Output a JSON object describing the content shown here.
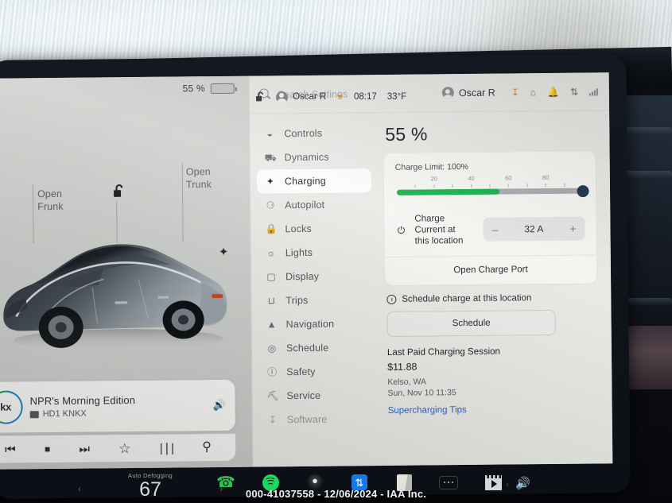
{
  "photo": {
    "watermark": "000-41037558 - 12/06/2024 - IAA Inc."
  },
  "vehicle_panel": {
    "battery_percent": "55 %",
    "controls": [
      {
        "label": "Open\nFrunk",
        "name": "open-frunk"
      },
      {
        "label": "Open\nTrunk",
        "name": "open-trunk"
      }
    ],
    "frunk_label_line1": "Open",
    "frunk_label_line2": "Frunk",
    "trunk_label_line1": "Open",
    "trunk_label_line2": "Trunk",
    "lock_icon": "unlocked-padlock-icon",
    "charge_bolt_icon": "lightning-bolt-icon"
  },
  "media": {
    "station_logo": "knkx",
    "title": "NPR's Morning Edition",
    "subtitle": "HD1 KNKX",
    "volume_icon": "volume-icon",
    "controls": [
      {
        "name": "previous-track-button",
        "glyph": "⏮"
      },
      {
        "name": "stop-button",
        "glyph": "■"
      },
      {
        "name": "next-track-button",
        "glyph": "⏭"
      },
      {
        "name": "favorite-button",
        "glyph": "☆"
      },
      {
        "name": "equalizer-button",
        "glyph": "⦀"
      },
      {
        "name": "search-media-button",
        "glyph": "⌕"
      }
    ]
  },
  "status_bar": {
    "lock_icon": "unlocked-padlock-icon",
    "driver_profile": "Oscar R",
    "charge_icon": "charge-icon",
    "time": "08:17",
    "temperature": "33°F"
  },
  "settings": {
    "search": {
      "placeholder": "Search Settings",
      "icon": "search-icon"
    },
    "header_user": "Oscar R",
    "header_icons": [
      {
        "name": "charging-status-icon",
        "glyph": "↧"
      },
      {
        "name": "garage-door-icon",
        "glyph": "⌂"
      },
      {
        "name": "bell-icon",
        "glyph": "☲"
      },
      {
        "name": "bluetooth-icon",
        "glyph": "⯅"
      },
      {
        "name": "signal-strength-icon",
        "glyph": ""
      }
    ],
    "nav_items": [
      {
        "label": "Controls",
        "icon": "toggle-icon",
        "glyph": "◑",
        "active": false
      },
      {
        "label": "Dynamics",
        "icon": "car-icon",
        "glyph": "⛟",
        "active": false
      },
      {
        "label": "Charging",
        "icon": "bolt-icon",
        "glyph": "⚡",
        "active": true
      },
      {
        "label": "Autopilot",
        "icon": "steering-wheel-icon",
        "glyph": "⊕",
        "active": false
      },
      {
        "label": "Locks",
        "icon": "lock-icon",
        "glyph": "ὑ2",
        "active": false
      },
      {
        "label": "Lights",
        "icon": "light-icon",
        "glyph": "☀",
        "active": false
      },
      {
        "label": "Display",
        "icon": "display-icon",
        "glyph": "▢",
        "active": false
      },
      {
        "label": "Trips",
        "icon": "trips-icon",
        "glyph": "⊓",
        "active": false
      },
      {
        "label": "Navigation",
        "icon": "navigation-icon",
        "glyph": "▲",
        "active": false
      },
      {
        "label": "Schedule",
        "icon": "schedule-icon",
        "glyph": "◎",
        "active": false
      },
      {
        "label": "Safety",
        "icon": "safety-icon",
        "glyph": "ⓘ",
        "active": false
      },
      {
        "label": "Service",
        "icon": "wrench-icon",
        "glyph": "⚒",
        "active": false
      },
      {
        "label": "Software",
        "icon": "software-icon",
        "glyph": "↧",
        "active": false
      }
    ],
    "charging": {
      "battery_percent": "55 %",
      "charge_limit_label": "Charge Limit: 100%",
      "charge_limit_value": 100,
      "battery_level_value": 55,
      "slider_ticks": [
        "20",
        "40",
        "60",
        "80"
      ],
      "charge_current_label_line1": "Charge Current at",
      "charge_current_label_line2": "this location",
      "charge_current_value": "32 A",
      "stepper_minus": "–",
      "stepper_plus": "+",
      "open_charge_port_label": "Open Charge Port",
      "schedule_checkbox_label": "Schedule charge at this location",
      "schedule_button_label": "Schedule",
      "last_session_title": "Last Paid Charging Session",
      "last_session_amount": "$11.88",
      "last_session_location": "Kelso, WA",
      "last_session_datetime": "Sun, Nov 10 11:35",
      "supercharging_tips_link": "Supercharging Tips",
      "link_color": "#2a63c8",
      "fill_color": "#18b24b"
    }
  },
  "taskbar": {
    "climate_label": "Auto Defogging",
    "climate_temp": "67",
    "left_arrow": "‹",
    "right_arrow": "›",
    "apps": [
      {
        "name": "phone-app-icon"
      },
      {
        "name": "spotify-app-icon"
      },
      {
        "name": "camera-app-icon"
      },
      {
        "name": "bluetooth-app-icon"
      },
      {
        "name": "notes-app-icon"
      },
      {
        "name": "more-apps-icon"
      },
      {
        "name": "video-app-icon"
      }
    ],
    "volume_icon": "volume-icon"
  }
}
